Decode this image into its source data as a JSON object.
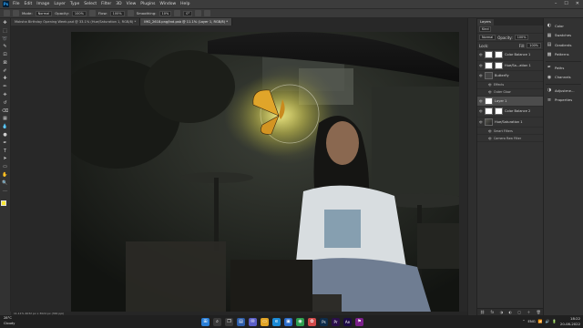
{
  "menu": {
    "logo": "Ps",
    "items": [
      "File",
      "Edit",
      "Image",
      "Layer",
      "Type",
      "Select",
      "Filter",
      "3D",
      "View",
      "Plugins",
      "Window",
      "Help"
    ],
    "window_controls": [
      "–",
      "☐",
      "✕"
    ]
  },
  "options_bar": {
    "mode_label": "Mode:",
    "mode_value": "Normal",
    "opacity_label": "Opacity:",
    "opacity_value": "100%",
    "flow_label": "Flow:",
    "flow_value": "100%",
    "smoothing_label": "Smoothing:",
    "smoothing_value": "10%",
    "angle_value": "0°"
  },
  "tabs": [
    {
      "label": "Moksha Birthday Opening Week.psd @ 33.1% (Hue/Saturation 1, RGB/8) *",
      "active": false
    },
    {
      "label": "IMG_2618.png/tnd.psb @ 11.1% (Layer 1, RGB/8) *",
      "active": true
    }
  ],
  "tools": [
    "move-icon",
    "marquee-icon",
    "lasso-icon",
    "quick-select-icon",
    "crop-icon",
    "frame-icon",
    "eyedropper-icon",
    "healing-icon",
    "brush-icon",
    "stamp-icon",
    "history-brush-icon",
    "eraser-icon",
    "gradient-icon",
    "blur-icon",
    "dodge-icon",
    "pen-icon",
    "type-icon",
    "path-select-icon",
    "rectangle-icon",
    "hand-icon",
    "zoom-icon",
    "more-icon"
  ],
  "tool_glyphs": [
    "✥",
    "⬚",
    "➰",
    "✎",
    "⊡",
    "⊠",
    "✐",
    "✚",
    "✏",
    "⎈",
    "↺",
    "⌫",
    "▦",
    "💧",
    "●",
    "✒",
    "T",
    "➤",
    "▭",
    "✋",
    "🔍",
    "…"
  ],
  "colors": {
    "foreground": "#f7e733",
    "background": "#ffffff",
    "accent": "#31a8ff"
  },
  "status": {
    "text": "11.11%   4032 px x 3024 px (300 ppi)"
  },
  "layers_panel": {
    "tab_label": "Layers",
    "kind_label": "Kind",
    "blend_mode": "Normal",
    "opacity_label": "Opacity:",
    "opacity_value": "100%",
    "lock_label": "Lock:",
    "fill_label": "Fill:",
    "fill_value": "100%",
    "layers": [
      {
        "name": "Color Balance 1",
        "thumb": "white",
        "mask": true,
        "selected": false,
        "sub": false
      },
      {
        "name": "Hue/Sa...ation 1",
        "thumb": "white",
        "mask": true,
        "selected": false,
        "sub": false
      },
      {
        "name": "Butterfly",
        "thumb": "dark",
        "mask": false,
        "selected": false,
        "sub": false
      },
      {
        "name": "Effects",
        "thumb": "",
        "mask": false,
        "selected": false,
        "sub": true
      },
      {
        "name": "Outer Glow",
        "thumb": "",
        "mask": false,
        "selected": false,
        "sub": true
      },
      {
        "name": "Layer 1",
        "thumb": "white",
        "mask": false,
        "selected": true,
        "sub": false
      },
      {
        "name": "Color Balance 2",
        "thumb": "white",
        "mask": true,
        "selected": false,
        "sub": false
      },
      {
        "name": "Hue/Saturation 1",
        "thumb": "photo",
        "mask": false,
        "selected": false,
        "sub": false
      },
      {
        "name": "Smart Filters",
        "thumb": "white",
        "mask": false,
        "selected": false,
        "sub": true
      },
      {
        "name": "Camera Raw Filter",
        "thumb": "",
        "mask": false,
        "selected": false,
        "sub": true
      }
    ],
    "footer_icons": [
      "⛓",
      "fx",
      "◑",
      "◐",
      "▢",
      "＋",
      "🗑"
    ]
  },
  "right_panels": [
    {
      "name": "Color",
      "glyph": "◐"
    },
    {
      "name": "Swatches",
      "glyph": "▦"
    },
    {
      "name": "Gradients",
      "glyph": "▤"
    },
    {
      "name": "Patterns",
      "glyph": "▩"
    },
    {
      "name": "",
      "glyph": ""
    },
    {
      "name": "Paths",
      "glyph": "✒"
    },
    {
      "name": "Channels",
      "glyph": "◉"
    },
    {
      "name": "",
      "glyph": ""
    },
    {
      "name": "Adjustme...",
      "glyph": "◑"
    },
    {
      "name": "Properties",
      "glyph": "≡"
    }
  ],
  "taskbar": {
    "weather_temp": "28°C",
    "weather_desc": "Cloudy",
    "apps": [
      {
        "name": "windows-start-icon",
        "glyph": "⊞",
        "color": "#2a7fd8"
      },
      {
        "name": "search-icon",
        "glyph": "⌕",
        "color": "#3a3a3a"
      },
      {
        "name": "task-view-icon",
        "glyph": "❐",
        "color": "#3a3a3a"
      },
      {
        "name": "widgets-icon",
        "glyph": "▤",
        "color": "#2d5da8"
      },
      {
        "name": "chat-icon",
        "glyph": "✉",
        "color": "#5b5fc7"
      },
      {
        "name": "explorer-icon",
        "glyph": "▭",
        "color": "#e0a325"
      },
      {
        "name": "edge-icon",
        "glyph": "e",
        "color": "#1b8ad6"
      },
      {
        "name": "store-icon",
        "glyph": "▣",
        "color": "#2b6bc9"
      },
      {
        "name": "chrome-icon",
        "glyph": "◉",
        "color": "#2e9e4f"
      },
      {
        "name": "photos-icon",
        "glyph": "✿",
        "color": "#d04a4a"
      },
      {
        "name": "photoshop-icon",
        "glyph": "Ps",
        "color": "#0e2c4a"
      },
      {
        "name": "premiere-icon",
        "glyph": "Pr",
        "color": "#2a0f4a"
      },
      {
        "name": "aftereffects-icon",
        "glyph": "Ae",
        "color": "#1d0b46"
      },
      {
        "name": "app-icon",
        "glyph": "⚑",
        "color": "#7a1f8a"
      }
    ],
    "time": "18:22",
    "date": "20-08-2022",
    "tray": [
      "⌃",
      "ENG",
      "📶",
      "🔊",
      "🔋"
    ]
  }
}
